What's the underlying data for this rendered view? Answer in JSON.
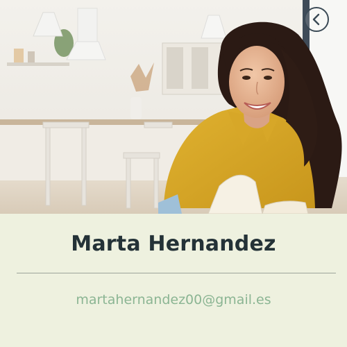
{
  "profile": {
    "name": "Marta Hernandez",
    "email": "martahernandez00@gmail.es"
  },
  "photo": {
    "alt": "Marta Hernandez"
  },
  "icons": {
    "back": "chevron-left-circle-icon"
  },
  "colors": {
    "panel_background": "#eef1df",
    "name_text": "#243237",
    "email_text": "#8bb593",
    "divider": "#9ba49a"
  }
}
